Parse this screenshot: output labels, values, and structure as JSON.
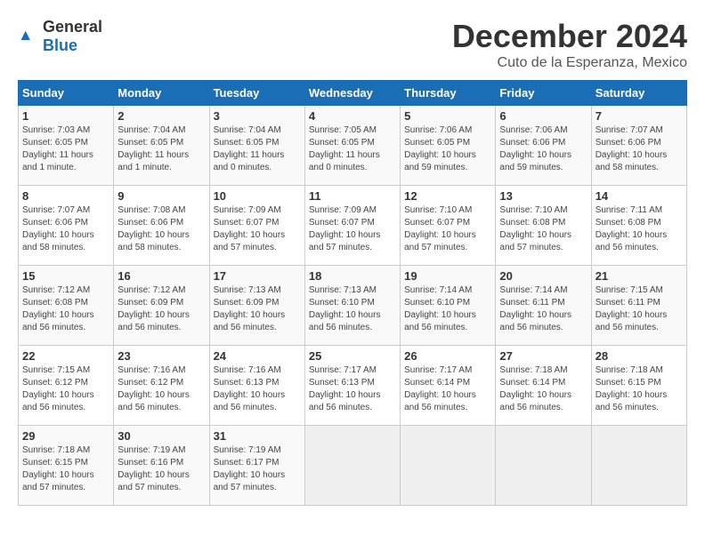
{
  "logo": {
    "general": "General",
    "blue": "Blue"
  },
  "header": {
    "title": "December 2024",
    "subtitle": "Cuto de la Esperanza, Mexico"
  },
  "weekdays": [
    "Sunday",
    "Monday",
    "Tuesday",
    "Wednesday",
    "Thursday",
    "Friday",
    "Saturday"
  ],
  "weeks": [
    [
      {
        "day": "1",
        "info": "Sunrise: 7:03 AM\nSunset: 6:05 PM\nDaylight: 11 hours and 1 minute."
      },
      {
        "day": "2",
        "info": "Sunrise: 7:04 AM\nSunset: 6:05 PM\nDaylight: 11 hours and 1 minute."
      },
      {
        "day": "3",
        "info": "Sunrise: 7:04 AM\nSunset: 6:05 PM\nDaylight: 11 hours and 0 minutes."
      },
      {
        "day": "4",
        "info": "Sunrise: 7:05 AM\nSunset: 6:05 PM\nDaylight: 11 hours and 0 minutes."
      },
      {
        "day": "5",
        "info": "Sunrise: 7:06 AM\nSunset: 6:05 PM\nDaylight: 10 hours and 59 minutes."
      },
      {
        "day": "6",
        "info": "Sunrise: 7:06 AM\nSunset: 6:06 PM\nDaylight: 10 hours and 59 minutes."
      },
      {
        "day": "7",
        "info": "Sunrise: 7:07 AM\nSunset: 6:06 PM\nDaylight: 10 hours and 58 minutes."
      }
    ],
    [
      {
        "day": "8",
        "info": "Sunrise: 7:07 AM\nSunset: 6:06 PM\nDaylight: 10 hours and 58 minutes."
      },
      {
        "day": "9",
        "info": "Sunrise: 7:08 AM\nSunset: 6:06 PM\nDaylight: 10 hours and 58 minutes."
      },
      {
        "day": "10",
        "info": "Sunrise: 7:09 AM\nSunset: 6:07 PM\nDaylight: 10 hours and 57 minutes."
      },
      {
        "day": "11",
        "info": "Sunrise: 7:09 AM\nSunset: 6:07 PM\nDaylight: 10 hours and 57 minutes."
      },
      {
        "day": "12",
        "info": "Sunrise: 7:10 AM\nSunset: 6:07 PM\nDaylight: 10 hours and 57 minutes."
      },
      {
        "day": "13",
        "info": "Sunrise: 7:10 AM\nSunset: 6:08 PM\nDaylight: 10 hours and 57 minutes."
      },
      {
        "day": "14",
        "info": "Sunrise: 7:11 AM\nSunset: 6:08 PM\nDaylight: 10 hours and 56 minutes."
      }
    ],
    [
      {
        "day": "15",
        "info": "Sunrise: 7:12 AM\nSunset: 6:08 PM\nDaylight: 10 hours and 56 minutes."
      },
      {
        "day": "16",
        "info": "Sunrise: 7:12 AM\nSunset: 6:09 PM\nDaylight: 10 hours and 56 minutes."
      },
      {
        "day": "17",
        "info": "Sunrise: 7:13 AM\nSunset: 6:09 PM\nDaylight: 10 hours and 56 minutes."
      },
      {
        "day": "18",
        "info": "Sunrise: 7:13 AM\nSunset: 6:10 PM\nDaylight: 10 hours and 56 minutes."
      },
      {
        "day": "19",
        "info": "Sunrise: 7:14 AM\nSunset: 6:10 PM\nDaylight: 10 hours and 56 minutes."
      },
      {
        "day": "20",
        "info": "Sunrise: 7:14 AM\nSunset: 6:11 PM\nDaylight: 10 hours and 56 minutes."
      },
      {
        "day": "21",
        "info": "Sunrise: 7:15 AM\nSunset: 6:11 PM\nDaylight: 10 hours and 56 minutes."
      }
    ],
    [
      {
        "day": "22",
        "info": "Sunrise: 7:15 AM\nSunset: 6:12 PM\nDaylight: 10 hours and 56 minutes."
      },
      {
        "day": "23",
        "info": "Sunrise: 7:16 AM\nSunset: 6:12 PM\nDaylight: 10 hours and 56 minutes."
      },
      {
        "day": "24",
        "info": "Sunrise: 7:16 AM\nSunset: 6:13 PM\nDaylight: 10 hours and 56 minutes."
      },
      {
        "day": "25",
        "info": "Sunrise: 7:17 AM\nSunset: 6:13 PM\nDaylight: 10 hours and 56 minutes."
      },
      {
        "day": "26",
        "info": "Sunrise: 7:17 AM\nSunset: 6:14 PM\nDaylight: 10 hours and 56 minutes."
      },
      {
        "day": "27",
        "info": "Sunrise: 7:18 AM\nSunset: 6:14 PM\nDaylight: 10 hours and 56 minutes."
      },
      {
        "day": "28",
        "info": "Sunrise: 7:18 AM\nSunset: 6:15 PM\nDaylight: 10 hours and 56 minutes."
      }
    ],
    [
      {
        "day": "29",
        "info": "Sunrise: 7:18 AM\nSunset: 6:15 PM\nDaylight: 10 hours and 57 minutes."
      },
      {
        "day": "30",
        "info": "Sunrise: 7:19 AM\nSunset: 6:16 PM\nDaylight: 10 hours and 57 minutes."
      },
      {
        "day": "31",
        "info": "Sunrise: 7:19 AM\nSunset: 6:17 PM\nDaylight: 10 hours and 57 minutes."
      },
      {
        "day": "",
        "info": ""
      },
      {
        "day": "",
        "info": ""
      },
      {
        "day": "",
        "info": ""
      },
      {
        "day": "",
        "info": ""
      }
    ]
  ]
}
